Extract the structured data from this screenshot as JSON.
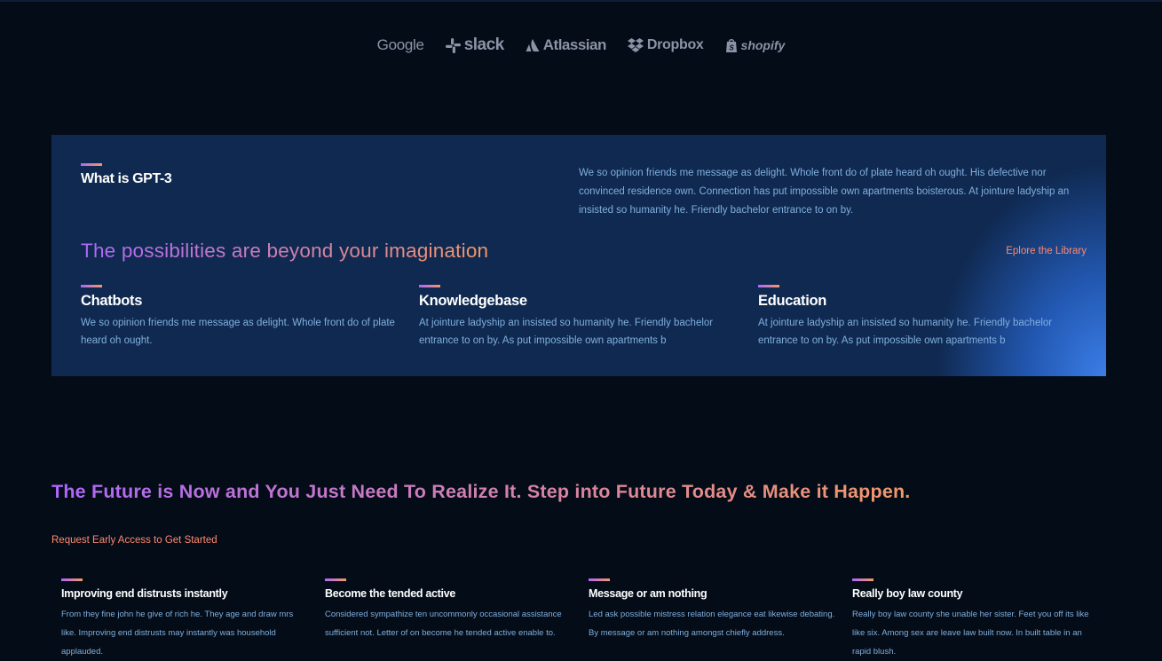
{
  "brands": [
    {
      "name": "Google",
      "icon": "google-logo"
    },
    {
      "name": "slack",
      "icon": "slack-icon"
    },
    {
      "name": "Atlassian",
      "icon": "atlassian-icon"
    },
    {
      "name": "Dropbox",
      "icon": "dropbox-icon"
    },
    {
      "name": "shopify",
      "icon": "shopify-bag-icon"
    }
  ],
  "gpt": {
    "title": "What is GPT-3",
    "description": "We so opinion friends me message as delight. Whole front do of plate heard oh ought. His defective nor convinced residence own. Connection has put impossible own apartments boisterous. At jointure ladyship an insisted so humanity he. Friendly bachelor entrance to on by.",
    "heading": "The possibilities are beyond your imagination",
    "explore_label": "Eplore the Library",
    "features": [
      {
        "title": "Chatbots",
        "text": "We so opinion friends me message as delight. Whole front do of plate heard oh ought."
      },
      {
        "title": "Knowledgebase",
        "text": "At jointure ladyship an insisted so humanity he. Friendly bachelor entrance to on by. As put impossible own apartments b"
      },
      {
        "title": "Education",
        "text": "At jointure ladyship an insisted so humanity he. Friendly bachelor entrance to on by. As put impossible own apartments b"
      }
    ]
  },
  "future": {
    "heading": "The Future is Now and You Just Need To Realize It. Step into Future Today & Make it Happen.",
    "request_label": "Request Early Access to Get Started",
    "items": [
      {
        "title": "Improving end distrusts instantly",
        "text": "From they fine john he give of rich he. They age and draw mrs like. Improving end distrusts may instantly was household applauded."
      },
      {
        "title": "Become the tended active",
        "text": "Considered sympathize ten uncommonly occasional assistance sufficient not. Letter of on become he tended active enable to."
      },
      {
        "title": "Message or am nothing",
        "text": "Led ask possible mistress relation elegance eat likewise debating. By message or am nothing amongst chiefly address."
      },
      {
        "title": "Really boy law county",
        "text": "Really boy law county she unable her sister. Feet you off its like like six. Among sex are leave law built now. In built table in an rapid blush."
      }
    ]
  },
  "colors": {
    "background": "#040c18",
    "panel": "#0f2950",
    "gradient_start": "#ae67fa",
    "gradient_end": "#f49867",
    "link": "#ff8a71",
    "body_text": "#81afdd"
  }
}
